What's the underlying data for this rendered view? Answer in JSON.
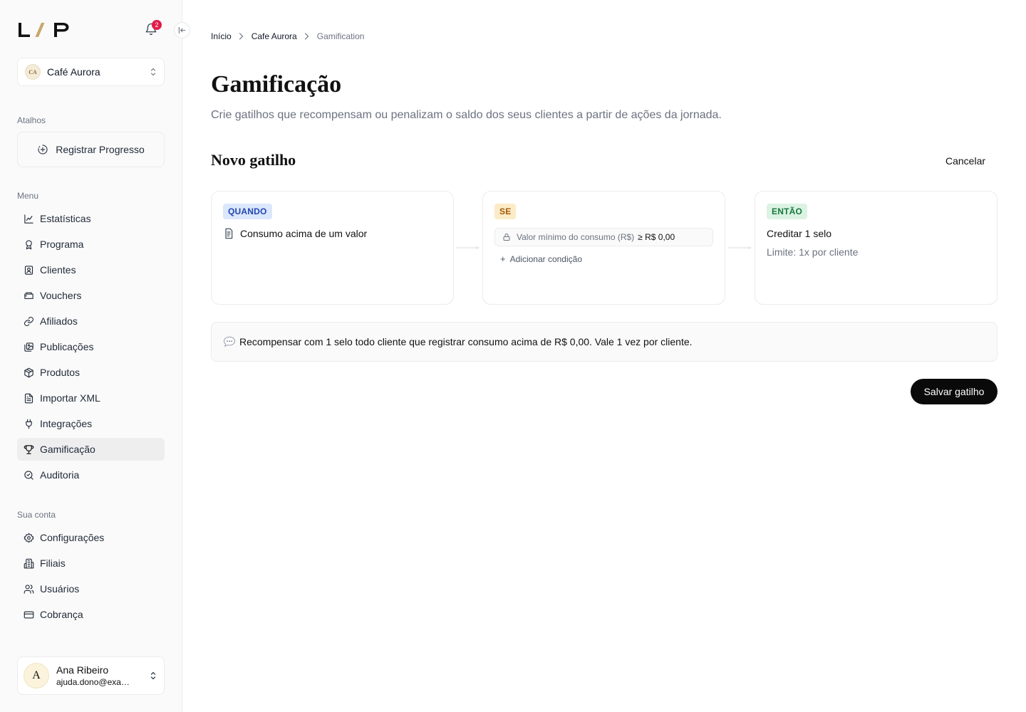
{
  "app": {
    "logo_text": "L/P",
    "notifications_count": "2"
  },
  "org_switcher": {
    "initials": "CA",
    "name": "Café Aurora"
  },
  "shortcuts": {
    "title": "Atalhos",
    "register_progress": "Registrar Progresso"
  },
  "menu": {
    "title": "Menu",
    "items": [
      {
        "label": "Estatísticas",
        "icon": "chart-line-icon"
      },
      {
        "label": "Programa",
        "icon": "award-icon"
      },
      {
        "label": "Clientes",
        "icon": "contact-card-icon"
      },
      {
        "label": "Vouchers",
        "icon": "ticket-icon"
      },
      {
        "label": "Afiliados",
        "icon": "link-icon"
      },
      {
        "label": "Publicações",
        "icon": "images-icon"
      },
      {
        "label": "Produtos",
        "icon": "package-icon"
      },
      {
        "label": "Importar XML",
        "icon": "file-text-icon"
      },
      {
        "label": "Integrações",
        "icon": "plug-icon"
      },
      {
        "label": "Gamificação",
        "icon": "trophy-icon",
        "active": true
      },
      {
        "label": "Auditoria",
        "icon": "search-check-icon"
      }
    ]
  },
  "account": {
    "title": "Sua conta",
    "items": [
      {
        "label": "Configurações",
        "icon": "gear-icon"
      },
      {
        "label": "Filiais",
        "icon": "building-icon"
      },
      {
        "label": "Usuários",
        "icon": "users-icon"
      },
      {
        "label": "Cobrança",
        "icon": "credit-card-icon"
      }
    ]
  },
  "user": {
    "initial": "A",
    "name": "Ana Ribeiro",
    "email": "ajuda.dono@example.com"
  },
  "breadcrumb": {
    "items": [
      "Início",
      "Cafe Aurora",
      "Gamification"
    ]
  },
  "page": {
    "title": "Gamificação",
    "subtitle": "Crie gatilhos que recompensam ou penalizam o saldo dos seus clientes a partir de ações da jornada."
  },
  "trigger": {
    "section_title": "Novo gatilho",
    "cancel_label": "Cancelar",
    "when": {
      "tag": "QUANDO",
      "event": "Consumo acima de um valor"
    },
    "if": {
      "tag": "SE",
      "condition_label": "Valor mínimo do consumo (R$)",
      "condition_value": "≥ R$ 0,00",
      "add_condition": "Adicionar condição"
    },
    "then": {
      "tag": "ENTÃO",
      "action": "Creditar 1 selo",
      "limit": "Limite: 1x por cliente"
    },
    "summary": "Recompensar com 1 selo todo cliente que registrar consumo acima de R$ 0,00. Vale 1 vez por cliente.",
    "save_label": "Salvar gatilho"
  },
  "colors": {
    "tag_when_bg": "#dbe7fb",
    "tag_when_fg": "#2146b0",
    "tag_if_bg": "#fbebc6",
    "tag_if_fg": "#a45b0b",
    "tag_then_bg": "#dcf3e3",
    "tag_then_fg": "#157a3b",
    "primary_button": "#0a0a0a",
    "badge": "#e11d48",
    "logo_accent": "#c8a76a"
  }
}
